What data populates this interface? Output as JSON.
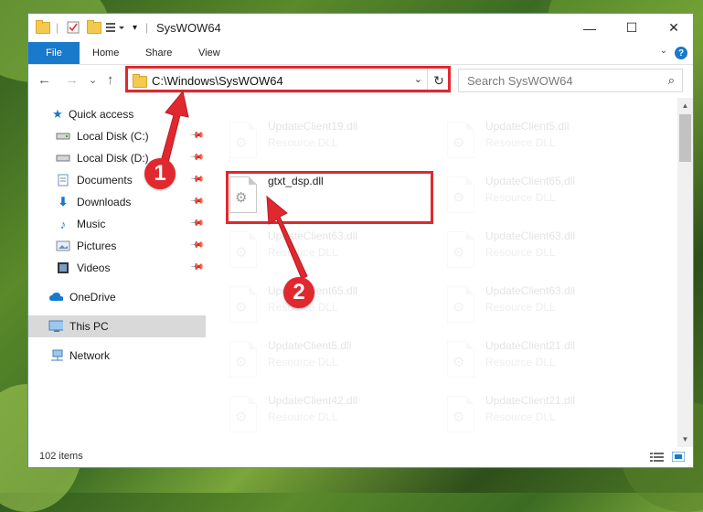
{
  "window": {
    "title": "SysWOW64",
    "controls": {
      "minimize": "—",
      "maximize": "☐",
      "close": "✕"
    }
  },
  "ribbon": {
    "tabs": [
      "File",
      "Home",
      "Share",
      "View"
    ],
    "help": "?"
  },
  "navigation": {
    "back": "←",
    "forward": "→",
    "recent": "⌄",
    "up": "↑",
    "address": "C:\\Windows\\SysWOW64",
    "refresh": "↻",
    "search_placeholder": "Search SysWOW64"
  },
  "sidebar": {
    "items": [
      {
        "label": "Quick access",
        "icon": "star-icon",
        "pinned": false
      },
      {
        "label": "Local Disk (C:)",
        "icon": "drive-icon",
        "pinned": true
      },
      {
        "label": "Local Disk (D:)",
        "icon": "drive-icon",
        "pinned": true
      },
      {
        "label": "Documents",
        "icon": "documents-icon",
        "pinned": true
      },
      {
        "label": "Downloads",
        "icon": "download-icon",
        "pinned": true
      },
      {
        "label": "Music",
        "icon": "music-icon",
        "pinned": true
      },
      {
        "label": "Pictures",
        "icon": "pictures-icon",
        "pinned": true
      },
      {
        "label": "Videos",
        "icon": "videos-icon",
        "pinned": true
      },
      {
        "label": "OneDrive",
        "icon": "cloud-icon",
        "pinned": false
      },
      {
        "label": "This PC",
        "icon": "computer-icon",
        "pinned": false,
        "selected": true
      },
      {
        "label": "Network",
        "icon": "network-icon",
        "pinned": false
      }
    ]
  },
  "files": [
    {
      "name": "UpdateClient19.dll",
      "type": "Resource DLL",
      "faded": true
    },
    {
      "name": "UpdateClient5.dll",
      "type": "Resource DLL",
      "faded": true
    },
    {
      "name": "gtxt_dsp.dll",
      "type": "",
      "faded": false
    },
    {
      "name": "UpdateClient65.dll",
      "type": "Resource DLL",
      "faded": true
    },
    {
      "name": "UpdateClient63.dll",
      "type": "Resource DLL",
      "faded": true
    },
    {
      "name": "UpdateClient63.dll",
      "type": "Resource DLL",
      "faded": true
    },
    {
      "name": "UpdateClient65.dll",
      "type": "Resource DLL",
      "faded": true
    },
    {
      "name": "UpdateClient63.dll",
      "type": "Resource DLL",
      "faded": true
    },
    {
      "name": "UpdateClient5.dll",
      "type": "Resource DLL",
      "faded": true
    },
    {
      "name": "UpdateClient21.dll",
      "type": "Resource DLL",
      "faded": true
    },
    {
      "name": "UpdateClient42.dll",
      "type": "Resource DLL",
      "faded": true
    },
    {
      "name": "UpdateClient21.dll",
      "type": "Resource DLL",
      "faded": true
    }
  ],
  "status": {
    "item_count": "102 items"
  },
  "annotations": {
    "step1": "1",
    "step2": "2"
  },
  "colors": {
    "accent": "#1979ca",
    "highlight": "#e0282e",
    "selection": "#d9d9d9"
  }
}
